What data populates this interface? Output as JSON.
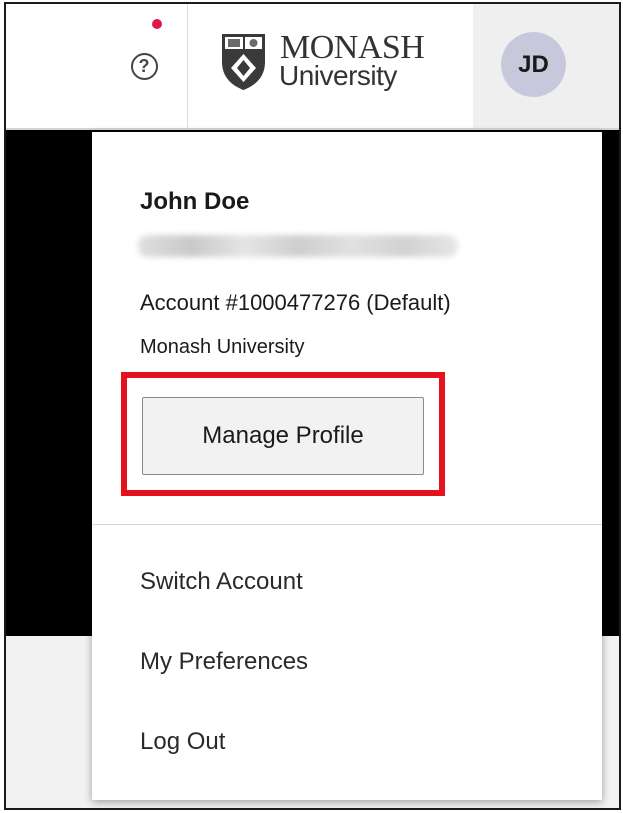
{
  "header": {
    "help_icon": "question-circle-icon",
    "help_symbol": "?",
    "notification_color": "#e3184a",
    "logo": {
      "line1": "MONASH",
      "line2": "University"
    },
    "avatar_initials": "JD"
  },
  "profile_menu": {
    "user_name": "John Doe",
    "account": "Account #1000477276 (Default)",
    "organization": "Monash University",
    "manage_profile_label": "Manage Profile",
    "items": [
      {
        "label": "Switch Account"
      },
      {
        "label": "My Preferences"
      },
      {
        "label": "Log Out"
      }
    ]
  },
  "colors": {
    "highlight": "#e3121c",
    "avatar_bg": "#c8c8dc"
  }
}
